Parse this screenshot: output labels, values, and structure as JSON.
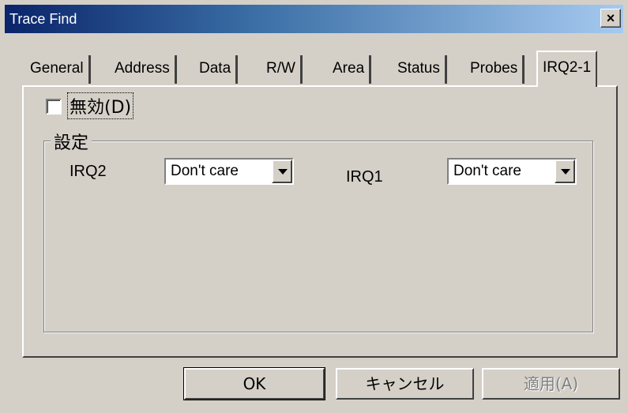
{
  "window": {
    "title": "Trace Find",
    "close_glyph": "×"
  },
  "tabs": [
    {
      "label": "General"
    },
    {
      "label": "Address"
    },
    {
      "label": "Data"
    },
    {
      "label": "R/W"
    },
    {
      "label": "Area"
    },
    {
      "label": "Status"
    },
    {
      "label": "Probes"
    },
    {
      "label": "IRQ2-1"
    }
  ],
  "active_tab": "IRQ2-1",
  "disable_checkbox": {
    "label": "無効(D)",
    "checked": false
  },
  "settings_group": {
    "label": "設定",
    "irq2": {
      "label": "IRQ2",
      "value": "Don't care"
    },
    "irq1": {
      "label": "IRQ1",
      "value": "Don't care"
    }
  },
  "buttons": {
    "ok": "OK",
    "cancel": "キャンセル",
    "apply": "適用(A)"
  }
}
